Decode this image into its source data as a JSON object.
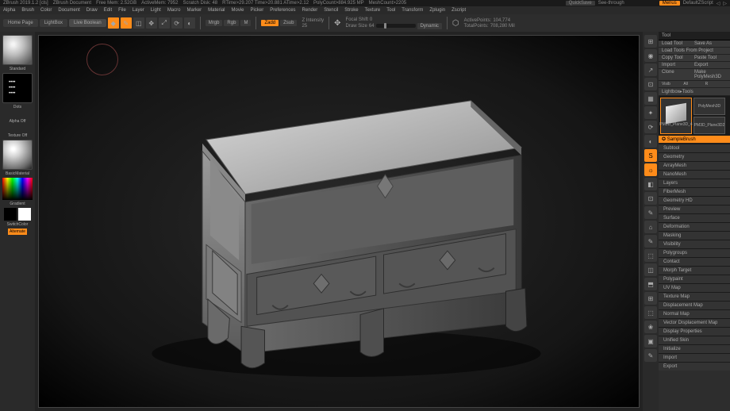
{
  "titlebar": {
    "app": "ZBrush 2019.1.2 [cls]",
    "doc": "ZBrush Document",
    "stats": [
      "Free Mem: 2.52GB",
      "ActiveMem: 7952",
      "Scratch Disk: 48",
      "RTime>29.207 Time>20.881 ATime>2.12",
      "PolyCount>884.925 MP",
      "MeshCount>2205"
    ],
    "quicksave": "QuickSave",
    "seethrough": "See-through",
    "menu": "Menus",
    "script": "DefaultZScript"
  },
  "menubar": [
    "Alpha",
    "Brush",
    "Color",
    "Document",
    "Draw",
    "Edit",
    "File",
    "Layer",
    "Light",
    "Macro",
    "Marker",
    "Material",
    "Movie",
    "Picker",
    "Preferences",
    "Render",
    "Stencil",
    "Stroke",
    "Texture",
    "Tool",
    "Transform",
    "Zplugin",
    "Zscript"
  ],
  "toolbar": {
    "tabs": [
      "Home Page",
      "LightBox",
      "Live Boolean"
    ],
    "modes": {
      "mrgb": "Mrgb",
      "rgb": "Rgb",
      "m": "M",
      "zadd": "Zadd",
      "zsub": "Zsub"
    },
    "intensity_label": "Z Intensity",
    "intensity_val": "25",
    "focal_label": "Focal Shift",
    "focal_val": "0",
    "draw_label": "Draw Size",
    "draw_val": "64",
    "dynamic": "Dynamic",
    "active_label": "ActivePoints:",
    "active_val": "104,774",
    "total_label": "TotalPoints:",
    "total_val": "708,280 Mil"
  },
  "left": {
    "brush": "Standard",
    "stroke": "Dots",
    "alpha": "Alpha Off",
    "texture": "Texture Off",
    "material": "BasicMaterial",
    "gradient": "Gradient",
    "switch": "SwitchColor",
    "alt": "Alternate"
  },
  "rightIcons": [
    "⊞",
    "◉",
    "↗",
    "⊡",
    "▦",
    "✦",
    "⟳",
    "◐",
    "S",
    "☼",
    "◧",
    "⊡",
    "✎",
    "⌂",
    "✎",
    "⬚",
    "◫",
    "⬒",
    "⊞",
    "⬚",
    "❀",
    "▣",
    "✎"
  ],
  "rightIconsOrange": [
    8,
    9
  ],
  "panel": {
    "title": "Tool",
    "loadTool": "Load Tool",
    "saveAs": "Save As",
    "loadProject": "Load Tools From Project",
    "copyTool": "Copy Tool",
    "pasteTool": "Paste Tool",
    "import": "Import",
    "export": "Export",
    "clone": "Clone",
    "make": "Make PolyMesh3D",
    "visib": "Visib",
    "all": "All",
    "r": "R",
    "lightbox": "Lightbox▸Tools",
    "thumb1": "PM3D_Plane3D_4",
    "thumb2": "PolyMesh3D",
    "thumb3": "PM3D_Plane3D2",
    "sample": "SampleBrush",
    "cats": [
      "Subtool",
      "Geometry",
      "ArrayMesh",
      "NanoMesh",
      "Layers",
      "FiberMesh",
      "Geometry HD",
      "Preview",
      "Surface",
      "Deformation",
      "Masking",
      "Visibility",
      "Polygroups",
      "Contact",
      "Morph Target",
      "Polypaint",
      "UV Map",
      "Texture Map",
      "Displacement Map",
      "Normal Map",
      "Vector Displacement Map",
      "Display Properties",
      "Unified Skin",
      "Initialize",
      "Import",
      "Export"
    ]
  }
}
